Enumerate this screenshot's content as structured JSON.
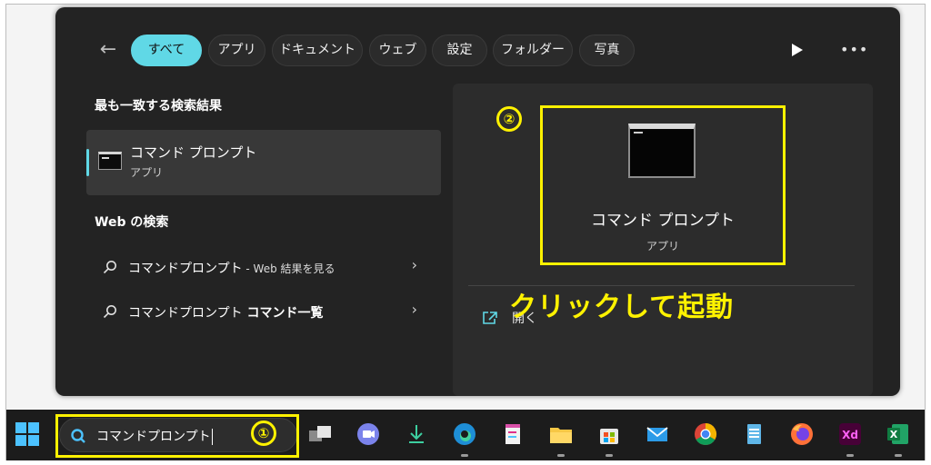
{
  "filter_bar": {
    "chips": [
      {
        "label": "すべて",
        "active": true
      },
      {
        "label": "アプリ",
        "active": false
      },
      {
        "label": "ドキュメント",
        "active": false
      },
      {
        "label": "ウェブ",
        "active": false
      },
      {
        "label": "設定",
        "active": false
      },
      {
        "label": "フォルダー",
        "active": false
      },
      {
        "label": "写真",
        "active": false
      }
    ]
  },
  "best_match": {
    "heading": "最も一致する検索結果",
    "name": "コマンド プロンプト",
    "type": "アプリ"
  },
  "web_search": {
    "heading": "Web の検索",
    "items": [
      {
        "query": "コマンドプロンプト",
        "suffix": " - Web 結果を見る",
        "bold": ""
      },
      {
        "query": "コマンドプロンプト",
        "suffix": "",
        "bold": " コマンド一覧"
      }
    ]
  },
  "preview": {
    "name": "コマンド プロンプト",
    "type": "アプリ",
    "open_label": "開く"
  },
  "annotations": {
    "step1": "①",
    "step2": "②",
    "callout": "クリックして起動"
  },
  "taskbar": {
    "search_value": "コマンドプロンプト"
  },
  "colors": {
    "accent": "#60d8e6",
    "annotation": "#fff200",
    "panel": "#232323"
  }
}
